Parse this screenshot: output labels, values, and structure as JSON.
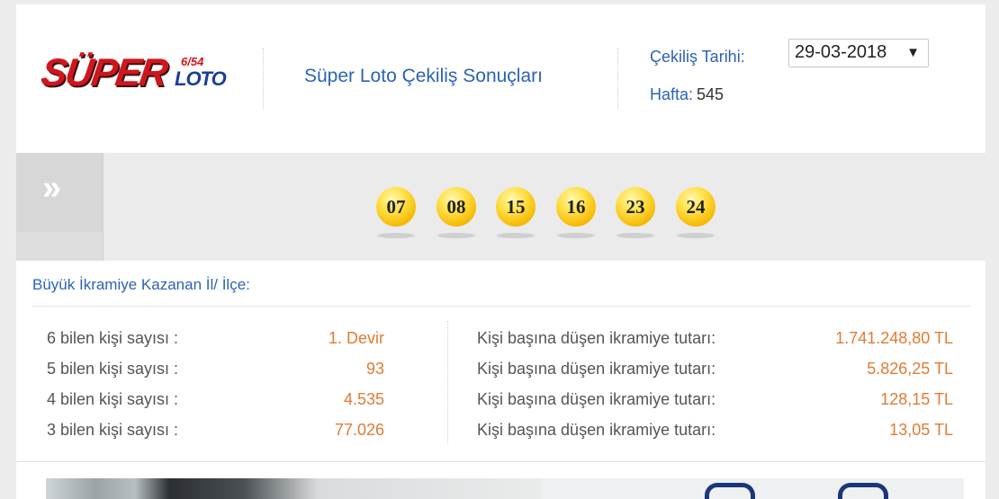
{
  "header": {
    "logo_main": "SÜPER",
    "logo_small": "6/54",
    "logo_sub": "LOTO",
    "title": "Süper Loto Çekiliş Sonuçları",
    "draw_date_label": "Çekiliş Tarihi:",
    "draw_date_value": "29-03-2018",
    "week_label": "Hafta:",
    "week_value": "545"
  },
  "side_tab": {
    "glyph": "»"
  },
  "balls": [
    "07",
    "08",
    "15",
    "16",
    "23",
    "24"
  ],
  "winners": {
    "section_label": "Büyük İkramiye Kazanan İl/ İlçe:",
    "rows": [
      {
        "label": "6 bilen kişi sayısı :",
        "count": "1. Devir",
        "prize_label": "Kişi başına düşen ikramiye tutarı:",
        "prize": "1.741.248,80 TL"
      },
      {
        "label": "5 bilen kişi sayısı :",
        "count": "93",
        "prize_label": "Kişi başına düşen ikramiye tutarı:",
        "prize": "5.826,25 TL"
      },
      {
        "label": "4 bilen kişi sayısı :",
        "count": "4.535",
        "prize_label": "Kişi başına düşen ikramiye tutarı:",
        "prize": "128,15 TL"
      },
      {
        "label": "3 bilen kişi sayısı :",
        "count": "77.026",
        "prize_label": "Kişi başına düşen ikramiye tutarı:",
        "prize": "13,05 TL"
      }
    ]
  },
  "colors": {
    "accent_blue": "#2c63b4",
    "value_orange": "#e07b35",
    "logo_red": "#d0161d",
    "logo_blue": "#1a3f96",
    "ball_yellow": "#f6b800"
  },
  "icons": {
    "side_tab": "double-chevron-right-icon",
    "select": "triangle-down-icon"
  }
}
